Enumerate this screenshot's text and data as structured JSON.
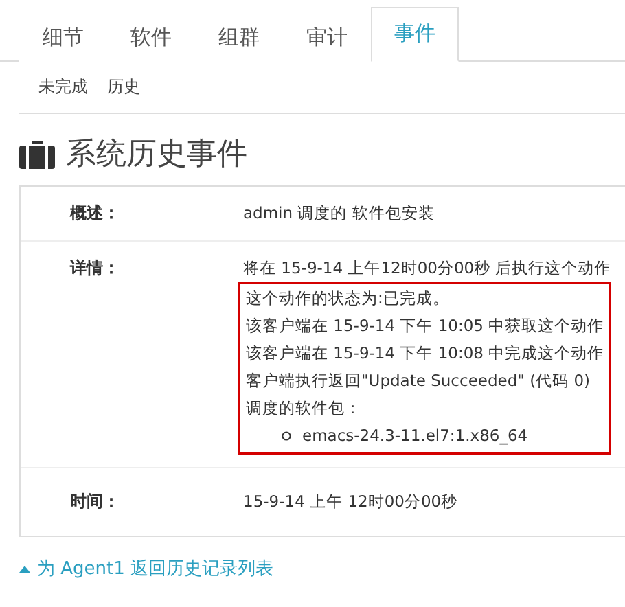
{
  "tabs": [
    {
      "label": "细节",
      "selected": false
    },
    {
      "label": "软件",
      "selected": false
    },
    {
      "label": "组群",
      "selected": false
    },
    {
      "label": "审计",
      "selected": false
    },
    {
      "label": "事件",
      "selected": true
    }
  ],
  "subtabs": [
    {
      "label": "未完成"
    },
    {
      "label": "历史"
    }
  ],
  "heading": "系统历史事件",
  "details": [
    {
      "label": "概述：",
      "lines": [
        "admin 调度的 软件包安装"
      ]
    },
    {
      "label": "详情：",
      "lines": [
        "将在 15-9-14 上午12时00分00秒 后执行这个动作"
      ],
      "highlighted_lines": [
        "这个动作的状态为:已完成。",
        "该客户端在 15-9-14 下午 10:05 中获取这个动作",
        "该客户端在 15-9-14 下午 10:08 中完成这个动作",
        "客户端执行返回\"Update Succeeded\" (代码 0)",
        "调度的软件包："
      ],
      "packages": [
        "emacs-24.3-11.el7:1.x86_64"
      ]
    },
    {
      "label": "时间：",
      "lines": [
        "15-9-14 上午 12时00分00秒"
      ]
    }
  ],
  "back_link": "为 Agent1 返回历史记录列表"
}
